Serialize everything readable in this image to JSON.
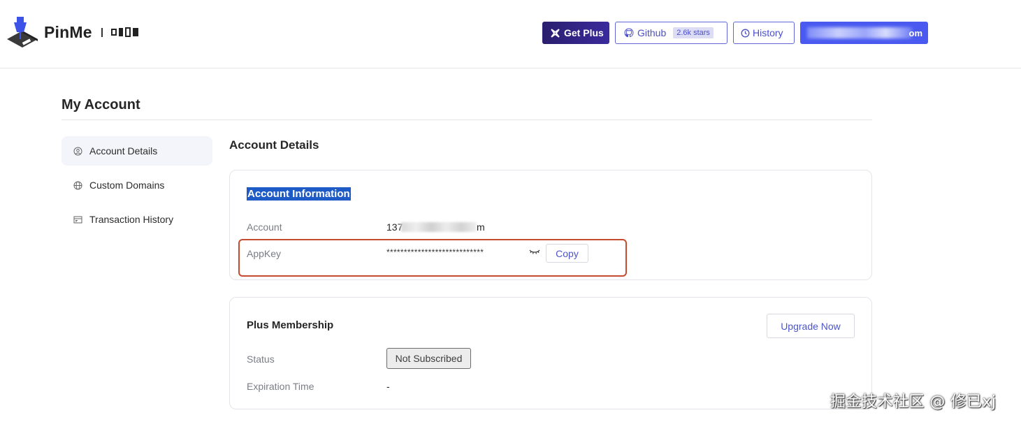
{
  "header": {
    "brand": "PinMe",
    "get_plus": "Get Plus",
    "github": "Github",
    "github_stars": "2.6k stars",
    "history": "History",
    "user_email_tail": "om"
  },
  "page": {
    "title": "My Account"
  },
  "sidebar": {
    "items": [
      {
        "label": "Account Details",
        "icon": "user-circle-icon",
        "active": true
      },
      {
        "label": "Custom Domains",
        "icon": "globe-icon",
        "active": false
      },
      {
        "label": "Transaction History",
        "icon": "receipt-icon",
        "active": false
      }
    ]
  },
  "main": {
    "section_title": "Account Details",
    "account_info": {
      "title": "Account Information",
      "account_label": "Account",
      "account_prefix": "137",
      "account_suffix": "m",
      "appkey_label": "AppKey",
      "appkey_masked": "****************************",
      "copy": "Copy"
    },
    "plus": {
      "title": "Plus Membership",
      "upgrade": "Upgrade Now",
      "status_label": "Status",
      "status_value": "Not Subscribed",
      "expiration_label": "Expiration Time",
      "expiration_value": "-"
    }
  },
  "watermark": "掘金技术社区 @ 修已xj",
  "colors": {
    "accent": "#4a5af0",
    "primary_text_button": "#4b55c9",
    "highlight_box": "#c64a2e",
    "selection": "#1f5bc6"
  }
}
